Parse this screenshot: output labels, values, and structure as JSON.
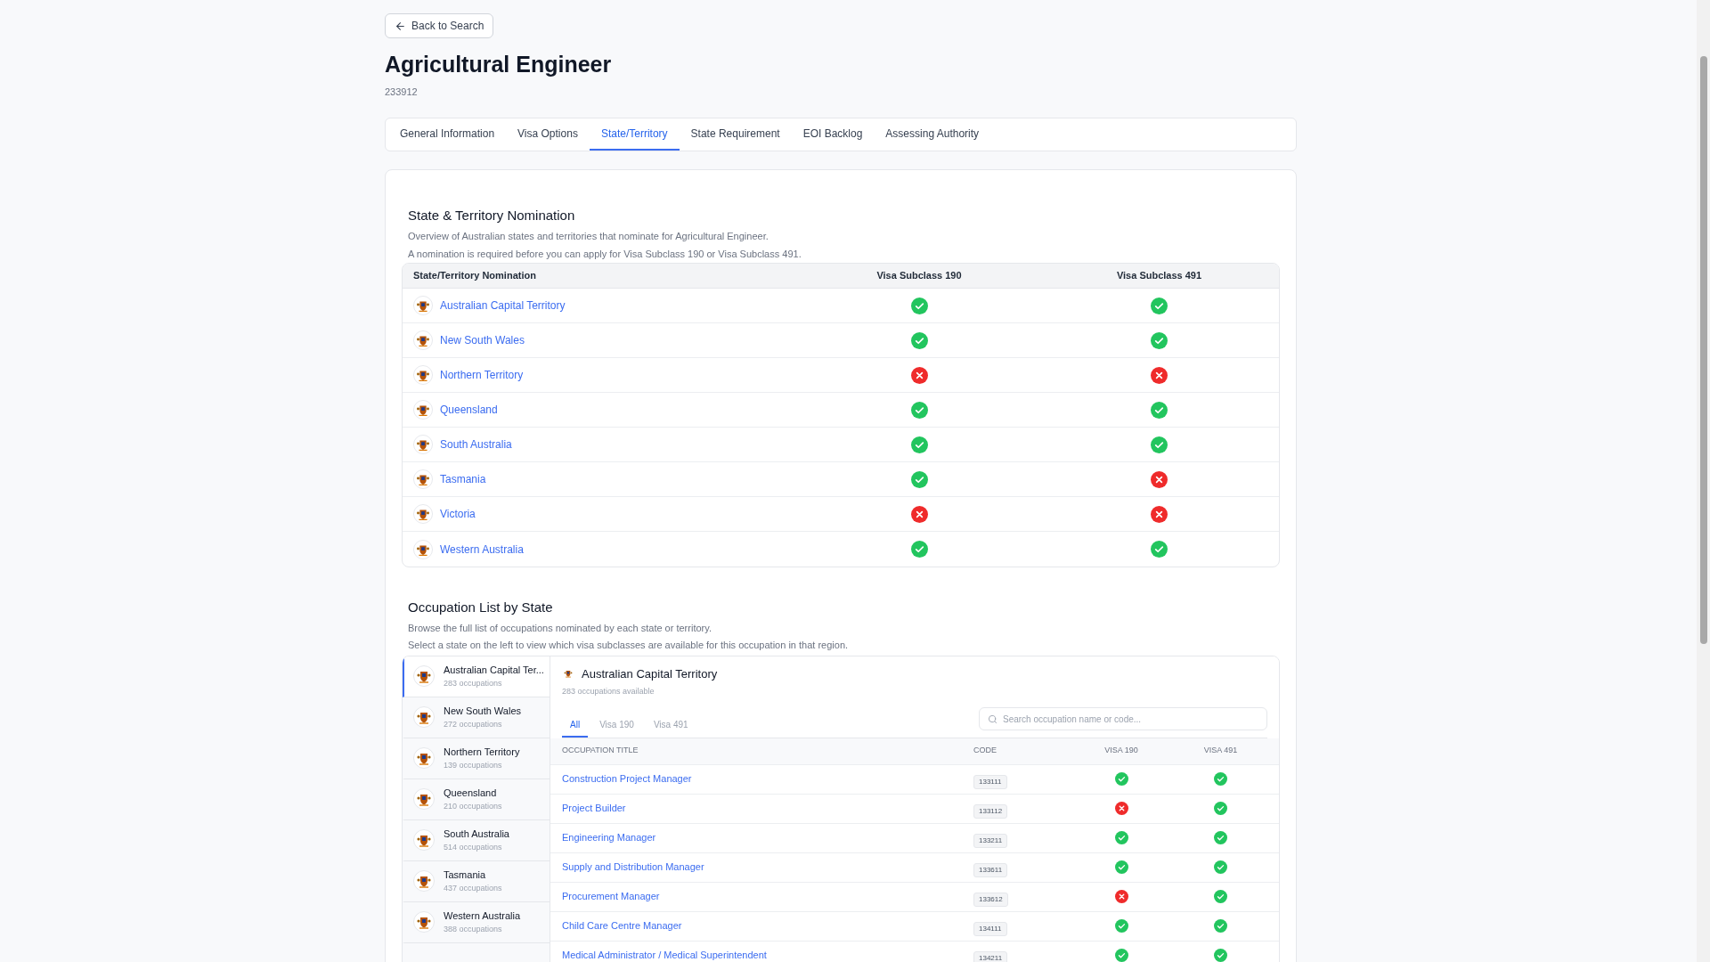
{
  "back_button": {
    "label": "Back to Search"
  },
  "occupation": {
    "title": "Agricultural Engineer",
    "code": "233912"
  },
  "tabs": [
    {
      "label": "General Information",
      "selected": false
    },
    {
      "label": "Visa Options",
      "selected": false
    },
    {
      "label": "State/Territory",
      "selected": true
    },
    {
      "label": "State Requirement",
      "selected": false
    },
    {
      "label": "EOI Backlog",
      "selected": false
    },
    {
      "label": "Assessing Authority",
      "selected": false
    }
  ],
  "nomination": {
    "title": "State & Territory Nomination",
    "lines": [
      "Overview of Australian states and territories that nominate for Agricultural Engineer.",
      "A nomination is required before you can apply for Visa Subclass 190 or Visa Subclass 491."
    ],
    "columns": [
      "State/Territory Nomination",
      "Visa Subclass 190",
      "Visa Subclass 491"
    ],
    "rows": [
      {
        "name": "Australian Capital Territory",
        "visa190": true,
        "visa491": true
      },
      {
        "name": "New South Wales",
        "visa190": true,
        "visa491": true
      },
      {
        "name": "Northern Territory",
        "visa190": false,
        "visa491": false
      },
      {
        "name": "Queensland",
        "visa190": true,
        "visa491": true
      },
      {
        "name": "South Australia",
        "visa190": true,
        "visa491": true
      },
      {
        "name": "Tasmania",
        "visa190": true,
        "visa491": false
      },
      {
        "name": "Victoria",
        "visa190": false,
        "visa491": false
      },
      {
        "name": "Western Australia",
        "visa190": true,
        "visa491": true
      }
    ]
  },
  "occupation_list": {
    "title": "Occupation List by State",
    "lines": [
      "Browse the full list of occupations nominated by each state or territory.",
      "Select a state on the left to view which visa subclasses are available for this occupation in that region."
    ],
    "states": [
      {
        "name": "Australian Capital Ter...",
        "count": "283 occupations",
        "selected": true
      },
      {
        "name": "New South Wales",
        "count": "272 occupations",
        "selected": false
      },
      {
        "name": "Northern Territory",
        "count": "139 occupations",
        "selected": false
      },
      {
        "name": "Queensland",
        "count": "210 occupations",
        "selected": false
      },
      {
        "name": "South Australia",
        "count": "514 occupations",
        "selected": false
      },
      {
        "name": "Tasmania",
        "count": "437 occupations",
        "selected": false
      },
      {
        "name": "Western Australia",
        "count": "388 occupations",
        "selected": false
      }
    ],
    "panel": {
      "title": "Australian Capital Territory",
      "subtitle": "283 occupations available",
      "filters": [
        {
          "label": "All",
          "selected": true
        },
        {
          "label": "Visa 190",
          "selected": false
        },
        {
          "label": "Visa 491",
          "selected": false
        }
      ],
      "search": {
        "placeholder": "Search occupation name or code..."
      },
      "columns": [
        "OCCUPATION TITLE",
        "CODE",
        "VISA 190",
        "VISA 491"
      ],
      "rows": [
        {
          "title": "Construction Project Manager",
          "code": "133111",
          "visa190": true,
          "visa491": true
        },
        {
          "title": "Project Builder",
          "code": "133112",
          "visa190": false,
          "visa491": true
        },
        {
          "title": "Engineering Manager",
          "code": "133211",
          "visa190": true,
          "visa491": true
        },
        {
          "title": "Supply and Distribution Manager",
          "code": "133611",
          "visa190": true,
          "visa491": true
        },
        {
          "title": "Procurement Manager",
          "code": "133612",
          "visa190": false,
          "visa491": true
        },
        {
          "title": "Child Care Centre Manager",
          "code": "134111",
          "visa190": true,
          "visa491": true
        },
        {
          "title": "Medical Administrator / Medical Superintendent",
          "code": "134211",
          "visa190": true,
          "visa491": true
        }
      ]
    }
  }
}
